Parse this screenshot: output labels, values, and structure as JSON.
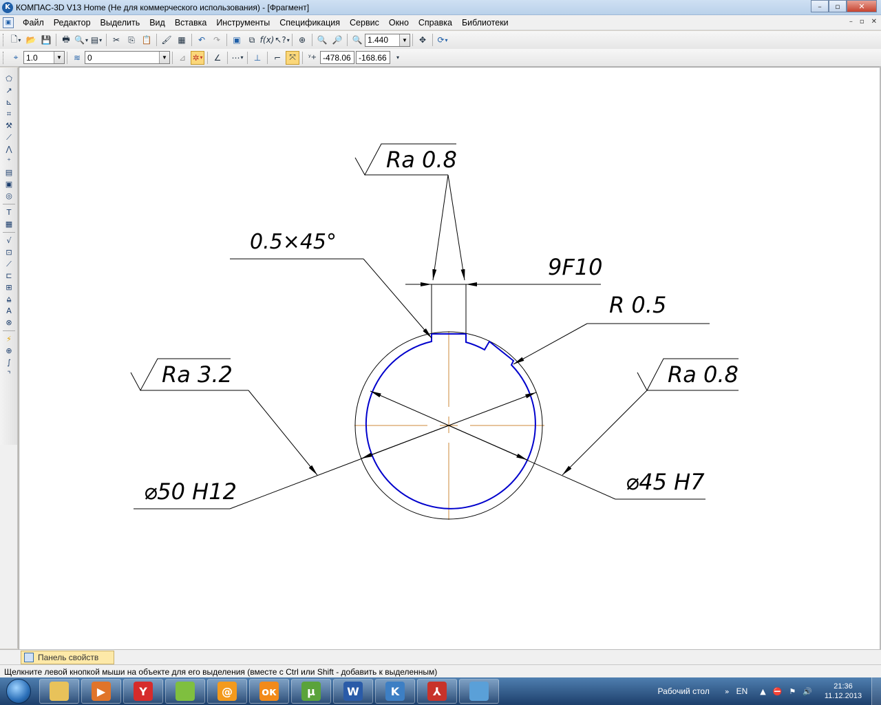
{
  "window": {
    "title": "КОМПАС-3D V13 Home (Не для коммерческого использования) - [Фрагмент]",
    "app_icon": "K",
    "minimize_icon": "–",
    "maximize_icon": "▫",
    "close_icon": "✕"
  },
  "menu": {
    "items": [
      "Файл",
      "Редактор",
      "Выделить",
      "Вид",
      "Вставка",
      "Инструменты",
      "Спецификация",
      "Сервис",
      "Окно",
      "Справка",
      "Библиотеки"
    ],
    "mdi_min": "–",
    "mdi_max": "▫",
    "mdi_close": "✕"
  },
  "toolbar1": {
    "zoom_value": "1.440",
    "icons": [
      "new-document-icon",
      "open-folder-icon",
      "save-icon",
      "print-icon",
      "print-preview-icon",
      "properties-icon",
      "cut-icon",
      "copy-icon",
      "paste-icon",
      "format-painter-icon",
      "library-manager-icon",
      "undo-icon",
      "redo-icon",
      "manager-icon",
      "variables-icon",
      "function-icon",
      "help-pointer-icon",
      "zoom-window-icon",
      "zoom-in-icon",
      "zoom-out-icon",
      "zoom-scale-icon",
      "pan-icon",
      "refresh-icon"
    ]
  },
  "toolbar2": {
    "step_value": "1.0",
    "layer_value": "0",
    "coord_x": "-478.06",
    "coord_y": "-168.66"
  },
  "left_toolbar": {
    "icons": [
      "geometry-icon",
      "dimensions-icon",
      "designations-icon",
      "edit-icon",
      "parameterization-icon",
      "measure-icon",
      "selection-icon",
      "associative-views-icon",
      "spec-icon",
      "reports-icon",
      "insert-icon",
      "text-icon",
      "table-icon",
      "roughness-icon",
      "base-icon",
      "leader-icon",
      "tolerance-icon",
      "section-icon",
      "arrow-view-icon",
      "axis-icon",
      "mark-icon",
      "snap-icon",
      "point-icon",
      "curve-icon",
      "bend-icon"
    ]
  },
  "drawing": {
    "labels": {
      "ra_top": "Ra 0.8",
      "chamfer": "0.5×45°",
      "width_tol": "9F10",
      "radius": "R 0.5",
      "ra_left": "Ra 3.2",
      "ra_right": "Ra 0.8",
      "outer_diam": "⌀50 H12",
      "inner_diam": "⌀45 H7"
    },
    "colors": {
      "line": "#000000",
      "contour": "#0000cc",
      "axis": "#cc8a3a"
    }
  },
  "property_panel": {
    "tab_label": "Панель свойств"
  },
  "status": {
    "text": "Щелкните левой кнопкой мыши на объекте для его выделения (вместе с Ctrl или Shift - добавить к выделенным)"
  },
  "taskbar": {
    "apps": [
      {
        "name": "explorer-icon",
        "glyph": "",
        "color": "#e8c25a"
      },
      {
        "name": "media-player-icon",
        "glyph": "▶",
        "color": "#e0742a"
      },
      {
        "name": "yandex-icon",
        "glyph": "Y",
        "color": "#d62b2b"
      },
      {
        "name": "browser-icon",
        "glyph": "",
        "color": "#7fbf3f"
      },
      {
        "name": "mail-agent-icon",
        "glyph": "@",
        "color": "#f39a1d"
      },
      {
        "name": "odnoklassniki-icon",
        "glyph": "ок",
        "color": "#f28a1a"
      },
      {
        "name": "utorrent-icon",
        "glyph": "µ",
        "color": "#5aa33b"
      },
      {
        "name": "word-icon",
        "glyph": "W",
        "color": "#2a5ba8"
      },
      {
        "name": "kompas-icon",
        "glyph": "K",
        "color": "#3d7fc4"
      },
      {
        "name": "pdf-icon",
        "glyph": "⅄",
        "color": "#c8332a"
      },
      {
        "name": "picture-viewer-icon",
        "glyph": "",
        "color": "#5aa0d8"
      }
    ],
    "desktop_label": "Рабочий стол",
    "lang": "EN",
    "time": "21:36",
    "date": "11.12.2013"
  }
}
